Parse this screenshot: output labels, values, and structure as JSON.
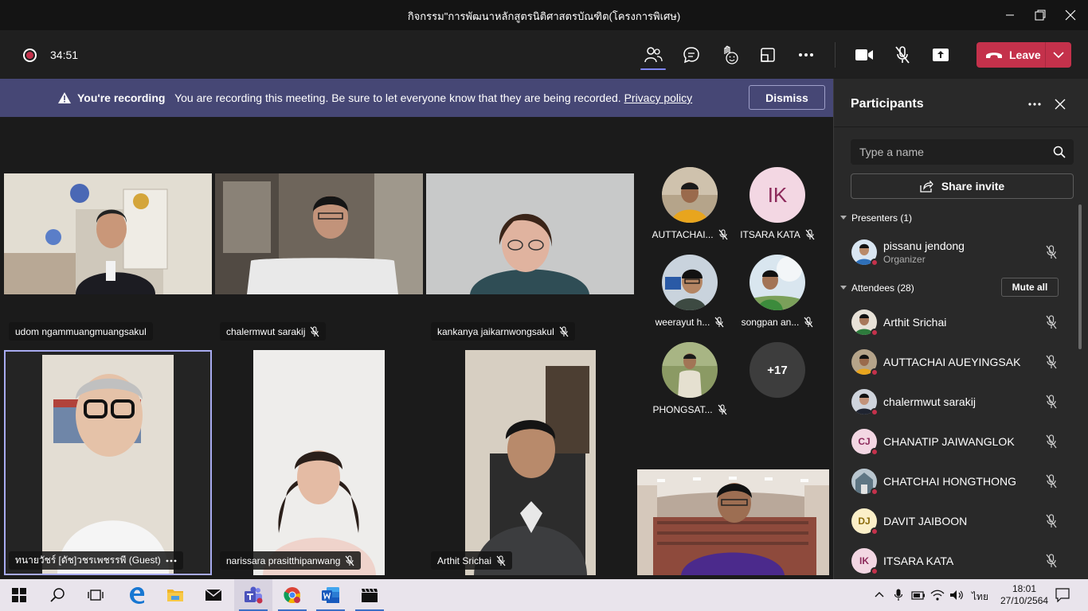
{
  "window": {
    "title": "กิจกรรม\"การพัฒนาหลักสูตรนิติศาสตรบัณฑิต(โครงการพิเศษ)"
  },
  "toolbar": {
    "timer": "34:51",
    "leave_label": "Leave"
  },
  "banner": {
    "bold": "You're recording",
    "message": "You are recording this meeting. Be sure to let everyone know that they are being recorded.",
    "link": "Privacy policy",
    "dismiss": "Dismiss"
  },
  "stage": {
    "tiles": [
      {
        "name": "udom ngammuangmuangsakul"
      },
      {
        "name": "chalermwut sarakij"
      },
      {
        "name": "kankanya jaikarnwongsakul"
      },
      {
        "name": "ทนายวัชร์ [ดัช]วชรเพชรรพี (Guest)"
      },
      {
        "name": "narissara prasitthipanwang"
      },
      {
        "name": "Arthit Srichai"
      }
    ],
    "avatars": [
      {
        "label": "AUTTACHAI..."
      },
      {
        "label": "ITSARA KATA",
        "initials": "IK"
      },
      {
        "label": "weerayut h..."
      },
      {
        "label": "songpan an..."
      },
      {
        "label": "PHONGSAT..."
      },
      {
        "label": "+17"
      }
    ]
  },
  "panel": {
    "title": "Participants",
    "search_placeholder": "Type a name",
    "share_invite": "Share invite",
    "presenters_header": "Presenters (1)",
    "attendees_header": "Attendees (28)",
    "mute_all": "Mute all",
    "presenters": [
      {
        "name": "pissanu jendong",
        "role": "Organizer"
      }
    ],
    "attendees": [
      {
        "name": "Arthit Srichai"
      },
      {
        "name": "AUTTACHAI AUEYINGSAK"
      },
      {
        "name": "chalermwut sarakij"
      },
      {
        "name": "CHANATIP JAIWANGLOK",
        "initials": "CJ"
      },
      {
        "name": "CHATCHAI HONGTHONG"
      },
      {
        "name": "DAVIT JAIBOON",
        "initials": "DJ"
      },
      {
        "name": "ITSARA KATA",
        "initials": "IK"
      }
    ]
  },
  "taskbar": {
    "language": "ไทย",
    "time": "18:01",
    "date": "27/10/2564"
  },
  "colors": {
    "accent": "#7f85f5",
    "leave": "#c4314b",
    "banner": "#464775"
  }
}
